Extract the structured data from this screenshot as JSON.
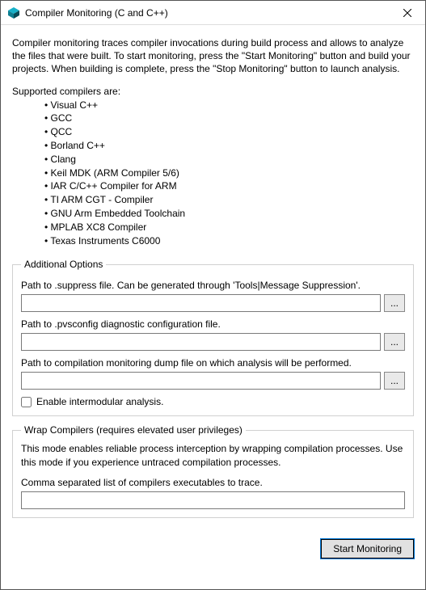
{
  "window": {
    "title": "Compiler Monitoring (C and C++)"
  },
  "intro": "Compiler monitoring traces compiler invocations during build process and allows to analyze the files that were built. To start monitoring, press the \"Start Monitoring\" button and build your projects. When building is complete, press the \"Stop Monitoring\" button to launch analysis.",
  "supported_label": "Supported compilers are:",
  "compilers": [
    "Visual C++",
    "GCC",
    "QCC",
    "Borland C++",
    "Clang",
    "Keil MDK (ARM Compiler 5/6)",
    "IAR C/C++ Compiler for ARM",
    "TI ARM CGT - Compiler",
    "GNU Arm Embedded Toolchain",
    "MPLAB XC8 Compiler",
    "Texas Instruments C6000"
  ],
  "additional_options": {
    "legend": "Additional Options",
    "suppress_label": "Path to .suppress file. Can be generated through 'Tools|Message Suppression'.",
    "suppress_value": "",
    "pvsconfig_label": "Path to .pvsconfig diagnostic configuration file.",
    "pvsconfig_value": "",
    "dump_label": "Path to compilation monitoring dump file on which analysis will be performed.",
    "dump_value": "",
    "browse_label": "...",
    "intermodular_checked": false,
    "intermodular_label": "Enable intermodular analysis."
  },
  "wrap": {
    "legend": "Wrap Compilers (requires elevated user privileges)",
    "description": "This mode enables reliable process interception by wrapping compilation processes. Use this mode if you experience untraced compilation processes.",
    "list_label": "Comma separated list of compilers executables to trace.",
    "list_value": ""
  },
  "footer": {
    "start_label": "Start Monitoring"
  }
}
